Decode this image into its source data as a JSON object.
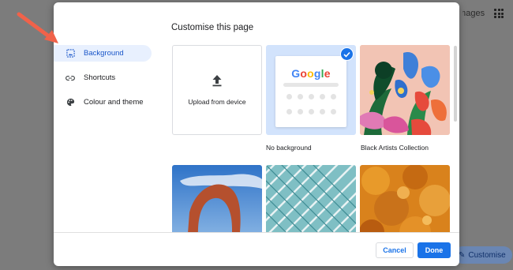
{
  "dialog": {
    "title": "Customise this page",
    "nav": [
      {
        "label": "Background",
        "icon": "image-icon",
        "active": true
      },
      {
        "label": "Shortcuts",
        "icon": "link-icon",
        "active": false
      },
      {
        "label": "Colour and theme",
        "icon": "palette-icon",
        "active": false
      }
    ],
    "tiles": {
      "upload_label": "Upload from device",
      "no_background_label": "No background",
      "black_artists_label": "Black Artists Collection",
      "logo": "Google"
    },
    "buttons": {
      "cancel": "Cancel",
      "done": "Done"
    }
  },
  "background_page": {
    "images_link": "Images",
    "customise_label": "Customise"
  },
  "colors": {
    "accent": "#1a73e8",
    "nav_active_bg": "#e8f0fe",
    "arrow": "#f0624a"
  }
}
